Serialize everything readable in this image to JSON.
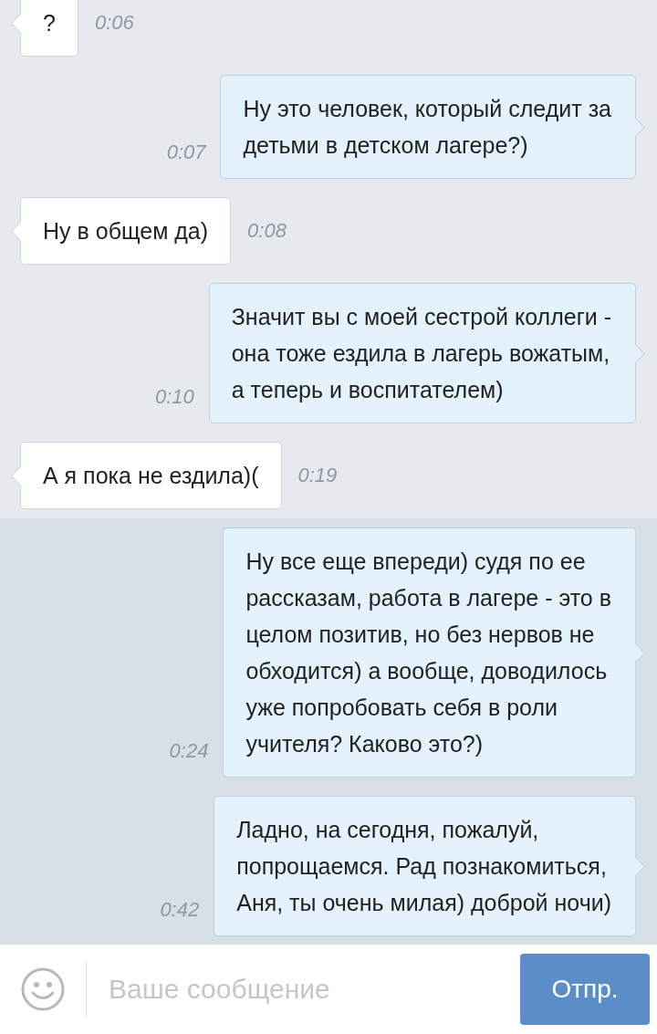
{
  "messages": [
    {
      "kind": "incoming",
      "text": "?",
      "time": "0:06",
      "highlighted": false
    },
    {
      "kind": "outgoing",
      "text": "Ну это человек, который следит за\nдетьми в детском лагере?)",
      "time": "0:07",
      "highlighted": false
    },
    {
      "kind": "incoming",
      "text": "Ну в общем да)",
      "time": "0:08",
      "highlighted": false
    },
    {
      "kind": "outgoing",
      "text": "Значит вы с моей сестрой коллеги -\nона тоже ездила в лагерь вожатым,\nа теперь и воспитателем)",
      "time": "0:10",
      "highlighted": false
    },
    {
      "kind": "incoming",
      "text": "А я пока не ездила)(",
      "time": "0:19",
      "highlighted": false
    },
    {
      "kind": "outgoing",
      "text": "Ну все еще впереди) судя по ее\nрассказам, работа в лагере - это в\nцелом позитив, но без нервов не\nобходится) а вообще, доводилось\nуже попробовать себя в роли\nучителя? Каково это?)",
      "time": "0:24",
      "highlighted": true
    },
    {
      "kind": "outgoing",
      "text": "Ладно, на сегодня, пожалуй,\nпопрощаемся. Рад познакомиться,\nАня, ты очень милая) доброй ночи)",
      "time": "0:42",
      "highlighted": true
    }
  ],
  "composer": {
    "placeholder": "Ваше сообщение",
    "send": "Отпр."
  }
}
